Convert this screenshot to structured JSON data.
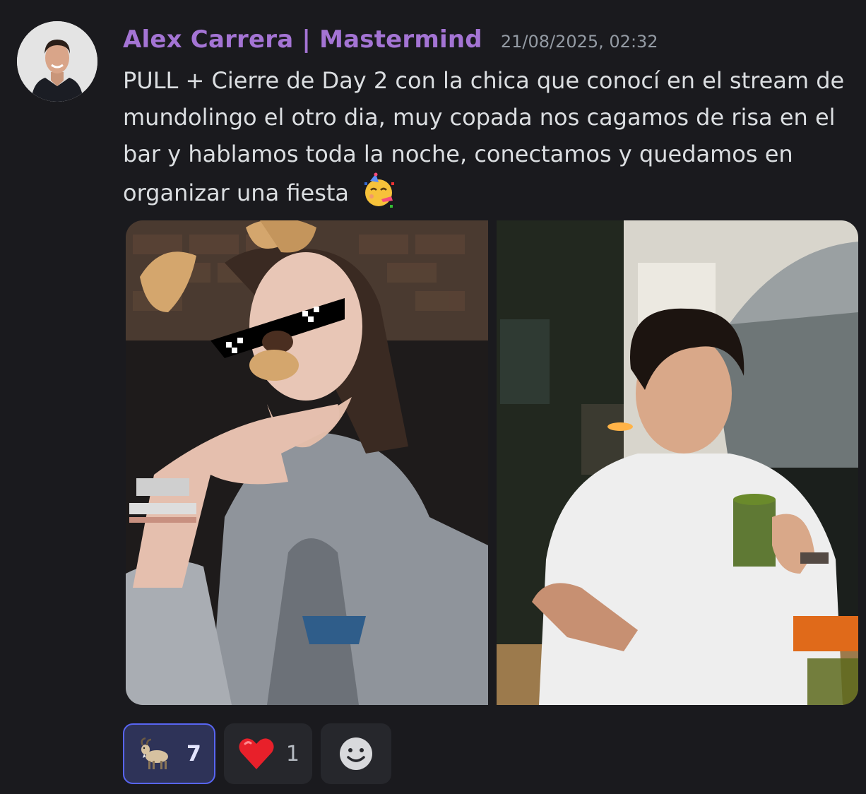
{
  "message": {
    "author": "Alex Carrera | Mastermind",
    "timestamp": "21/08/2025, 02:32",
    "text": "PULL + Cierre de Day 2 con la chica que conocí en el stream de mundolingo el otro dia, muy copada nos cagamos de risa en el bar y hablamos toda la noche, conectamos y quedamos en organizar una fiesta",
    "text_emoji": "partying-face-icon",
    "author_color": "#a474d4"
  },
  "attachments": [
    {
      "icon": "photo-woman-dog-filter"
    },
    {
      "icon": "photo-man-bar"
    }
  ],
  "reactions": [
    {
      "emoji": "goat-icon",
      "count": "7",
      "selected": true
    },
    {
      "emoji": "red-heart-icon",
      "count": "1",
      "selected": false
    }
  ],
  "add_reaction": {
    "icon": "add-reaction-smile-icon"
  }
}
